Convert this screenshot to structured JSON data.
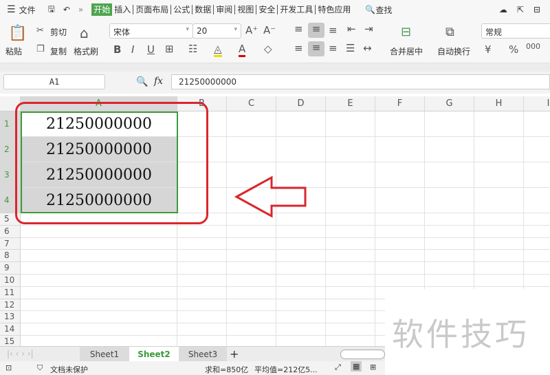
{
  "menu": {
    "file": "文件",
    "tabs": [
      "开始",
      "插入",
      "页面布局",
      "公式",
      "数据",
      "审阅",
      "视图",
      "安全",
      "开发工具",
      "特色应用"
    ],
    "search": "查找"
  },
  "toolbar": {
    "paste": "粘贴",
    "cut": "剪切",
    "copy": "复制",
    "format_painter": "格式刷",
    "font": "宋体",
    "font_size": "20",
    "merge": "合并居中",
    "wrap": "自动换行",
    "number_format": "常规"
  },
  "formula": {
    "cell_ref": "A1",
    "fx": "fx",
    "value": "21250000000"
  },
  "columns": [
    "A",
    "B",
    "C",
    "D",
    "E",
    "F",
    "G",
    "H",
    "I"
  ],
  "rows": [
    "1",
    "2",
    "3",
    "4",
    "5",
    "6",
    "7",
    "8",
    "9",
    "10",
    "11",
    "12",
    "13",
    "14",
    "15"
  ],
  "cells": [
    "21250000000",
    "21250000000",
    "21250000000",
    "21250000000"
  ],
  "sheets": [
    "Sheet1",
    "Sheet2",
    "Sheet3"
  ],
  "active_sheet": "Sheet2",
  "status": {
    "protect": "文档未保护",
    "sum": "求和=850亿",
    "avg": "平均值=212亿5..."
  },
  "watermark": "软件技巧",
  "colors": {
    "accent": "#4ea54e",
    "annotation": "#d9262c"
  }
}
